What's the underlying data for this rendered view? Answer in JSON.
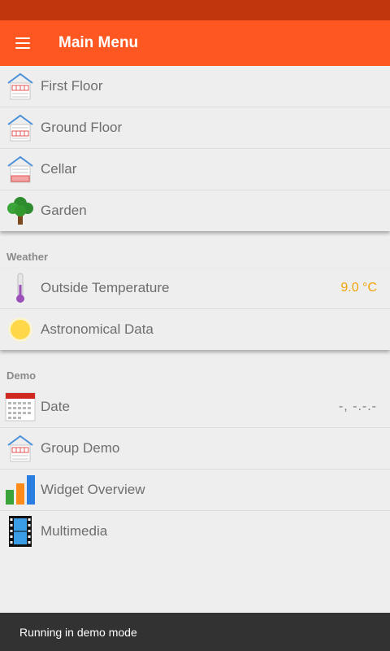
{
  "app_bar": {
    "title": "Main Menu"
  },
  "main_items": [
    {
      "label": "First Floor",
      "icon": "house-icon"
    },
    {
      "label": "Ground Floor",
      "icon": "house-icon"
    },
    {
      "label": "Cellar",
      "icon": "house-icon"
    },
    {
      "label": "Garden",
      "icon": "tree-icon"
    }
  ],
  "weather": {
    "header": "Weather",
    "items": [
      {
        "label": "Outside Temperature",
        "value": "9.0 °C",
        "icon": "thermometer-icon"
      },
      {
        "label": "Astronomical Data",
        "icon": "sun-icon"
      }
    ]
  },
  "demo": {
    "header": "Demo",
    "items": [
      {
        "label": "Date",
        "value": "-, -.-.-",
        "icon": "calendar-icon"
      },
      {
        "label": "Group Demo",
        "icon": "house-icon"
      },
      {
        "label": "Widget Overview",
        "icon": "bar-chart-icon"
      },
      {
        "label": "Multimedia",
        "icon": "film-icon"
      }
    ]
  },
  "snackbar": {
    "text": "Running in demo mode"
  },
  "colors": {
    "app_bar": "#ff5722",
    "status_bar": "#c1360d",
    "value_accent": "#f0a30a",
    "snackbar": "#323232"
  }
}
